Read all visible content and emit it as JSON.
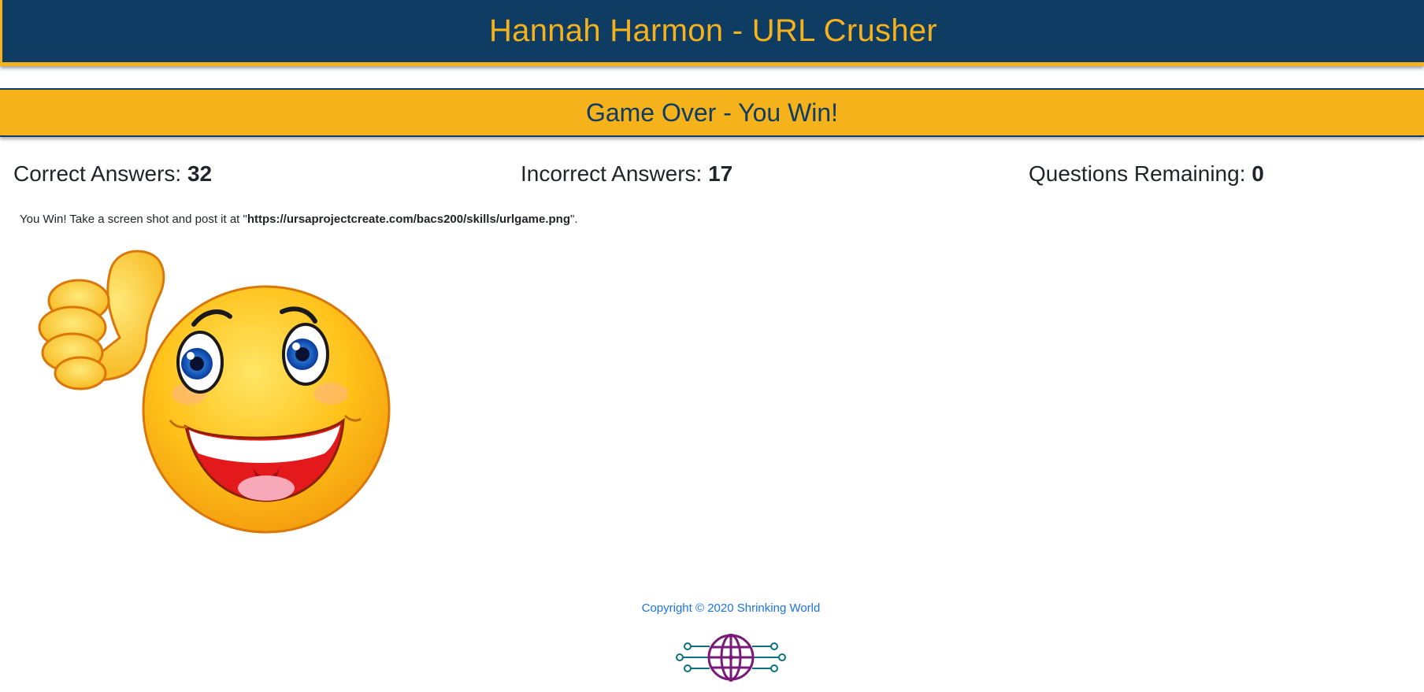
{
  "header": {
    "title": "Hannah Harmon - URL Crusher"
  },
  "banner": {
    "status": "Game Over - You Win!"
  },
  "stats": {
    "correct_label": "Correct Answers: ",
    "correct_value": "32",
    "incorrect_label": "Incorrect Answers: ",
    "incorrect_value": "17",
    "remaining_label": "Questions Remaining: ",
    "remaining_value": "0"
  },
  "message": {
    "prefix": "You Win! Take a screen shot and post it at \"",
    "url": "https://ursaprojectcreate.com/bacs200/skills/urlgame.png",
    "suffix": "\"."
  },
  "image": {
    "icon": "thumbs-up-smiley-icon"
  },
  "footer": {
    "copyright": "Copyright © 2020 Shrinking World",
    "logo_icon": "circuit-globe-logo-icon"
  },
  "colors": {
    "header_bg": "#0f3c63",
    "accent": "#f5b21a",
    "link": "#1a73e8"
  }
}
